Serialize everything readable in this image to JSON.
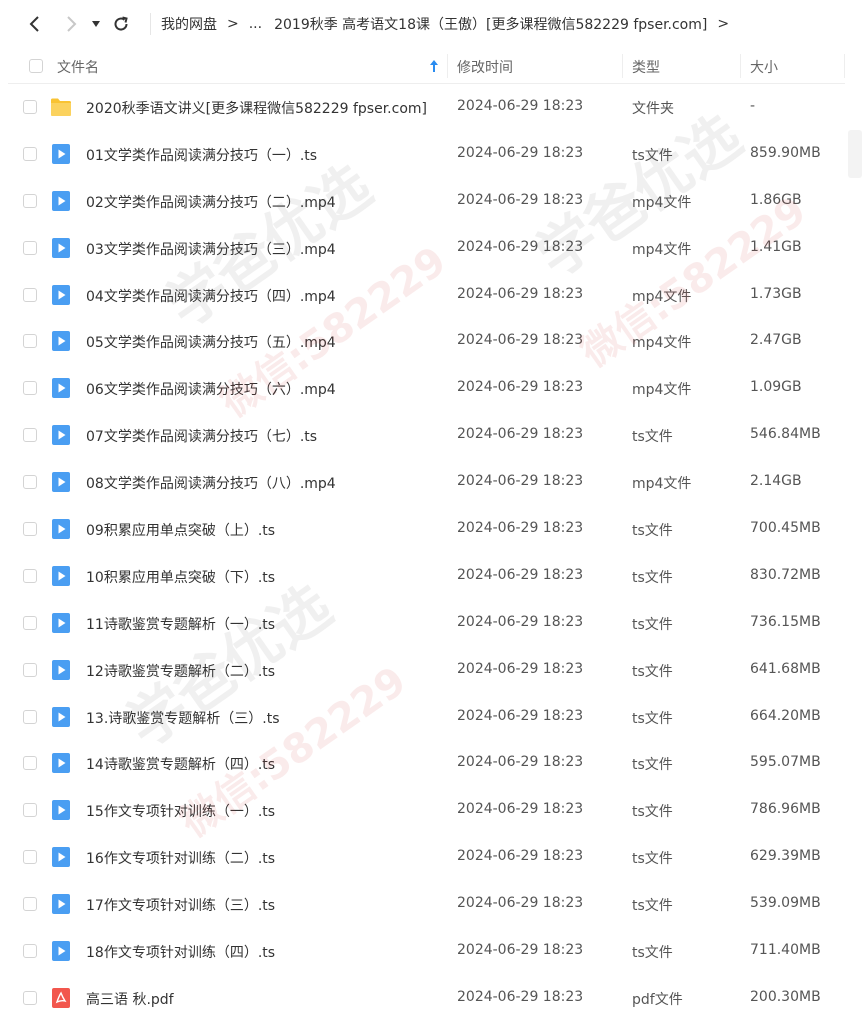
{
  "nav": {
    "back_icon": "chevron-left-icon",
    "forward_icon": "chevron-right-icon",
    "dropdown_icon": "caret-down-icon",
    "refresh_icon": "refresh-icon"
  },
  "breadcrumb": {
    "root": "我的网盘",
    "ellipsis": "...",
    "current": "2019秋季 高考语文18课（王傲）[更多课程微信582229 fpser.com]",
    "separator": ">"
  },
  "table": {
    "headers": {
      "name": "文件名",
      "time": "修改时间",
      "type": "类型",
      "size": "大小"
    },
    "rows": [
      {
        "name": "2020秋季语文讲义[更多课程微信582229 fpser.com]",
        "time": "2024-06-29 18:23",
        "type": "文件夹",
        "size": "-",
        "icon": "folder-icon"
      },
      {
        "name": "01文学类作品阅读满分技巧（一）.ts",
        "time": "2024-06-29 18:23",
        "type": "ts文件",
        "size": "859.90MB",
        "icon": "video-file-icon"
      },
      {
        "name": "02文学类作品阅读满分技巧（二）.mp4",
        "time": "2024-06-29 18:23",
        "type": "mp4文件",
        "size": "1.86GB",
        "icon": "video-file-icon"
      },
      {
        "name": "03文学类作品阅读满分技巧（三）.mp4",
        "time": "2024-06-29 18:23",
        "type": "mp4文件",
        "size": "1.41GB",
        "icon": "video-file-icon"
      },
      {
        "name": "04文学类作品阅读满分技巧（四）.mp4",
        "time": "2024-06-29 18:23",
        "type": "mp4文件",
        "size": "1.73GB",
        "icon": "video-file-icon"
      },
      {
        "name": "05文学类作品阅读满分技巧（五）.mp4",
        "time": "2024-06-29 18:23",
        "type": "mp4文件",
        "size": "2.47GB",
        "icon": "video-file-icon"
      },
      {
        "name": "06文学类作品阅读满分技巧（六）.mp4",
        "time": "2024-06-29 18:23",
        "type": "mp4文件",
        "size": "1.09GB",
        "icon": "video-file-icon"
      },
      {
        "name": "07文学类作品阅读满分技巧（七）.ts",
        "time": "2024-06-29 18:23",
        "type": "ts文件",
        "size": "546.84MB",
        "icon": "video-file-icon"
      },
      {
        "name": "08文学类作品阅读满分技巧（八）.mp4",
        "time": "2024-06-29 18:23",
        "type": "mp4文件",
        "size": "2.14GB",
        "icon": "video-file-icon"
      },
      {
        "name": "09积累应用单点突破（上）.ts",
        "time": "2024-06-29 18:23",
        "type": "ts文件",
        "size": "700.45MB",
        "icon": "video-file-icon"
      },
      {
        "name": "10积累应用单点突破（下）.ts",
        "time": "2024-06-29 18:23",
        "type": "ts文件",
        "size": "830.72MB",
        "icon": "video-file-icon"
      },
      {
        "name": "11诗歌鉴赏专题解析（一）.ts",
        "time": "2024-06-29 18:23",
        "type": "ts文件",
        "size": "736.15MB",
        "icon": "video-file-icon"
      },
      {
        "name": "12诗歌鉴赏专题解析（二）.ts",
        "time": "2024-06-29 18:23",
        "type": "ts文件",
        "size": "641.68MB",
        "icon": "video-file-icon"
      },
      {
        "name": "13.诗歌鉴赏专题解析（三）.ts",
        "time": "2024-06-29 18:23",
        "type": "ts文件",
        "size": "664.20MB",
        "icon": "video-file-icon"
      },
      {
        "name": "14诗歌鉴赏专题解析（四）.ts",
        "time": "2024-06-29 18:23",
        "type": "ts文件",
        "size": "595.07MB",
        "icon": "video-file-icon"
      },
      {
        "name": "15作文专项针对训练（一）.ts",
        "time": "2024-06-29 18:23",
        "type": "ts文件",
        "size": "786.96MB",
        "icon": "video-file-icon"
      },
      {
        "name": "16作文专项针对训练（二）.ts",
        "time": "2024-06-29 18:23",
        "type": "ts文件",
        "size": "629.39MB",
        "icon": "video-file-icon"
      },
      {
        "name": "17作文专项针对训练（三）.ts",
        "time": "2024-06-29 18:23",
        "type": "ts文件",
        "size": "539.09MB",
        "icon": "video-file-icon"
      },
      {
        "name": "18作文专项针对训练（四）.ts",
        "time": "2024-06-29 18:23",
        "type": "ts文件",
        "size": "711.40MB",
        "icon": "video-file-icon"
      },
      {
        "name": "高三语 秋.pdf",
        "time": "2024-06-29 18:23",
        "type": "pdf文件",
        "size": "200.30MB",
        "icon": "pdf-file-icon"
      }
    ]
  },
  "colors": {
    "folder": "#F9C333",
    "video": "#4A9EF2",
    "pdf": "#F2564D",
    "sort_arrow": "#2A8CF0"
  },
  "watermarks": [
    {
      "text": "学爸优选",
      "color": "gray"
    },
    {
      "text": "微信:582229",
      "color": "red"
    },
    {
      "text": "学爸优选",
      "color": "gray"
    },
    {
      "text": "微信:582229",
      "color": "red"
    },
    {
      "text": "学爸优选",
      "color": "gray"
    },
    {
      "text": "微信:582229",
      "color": "red"
    }
  ]
}
